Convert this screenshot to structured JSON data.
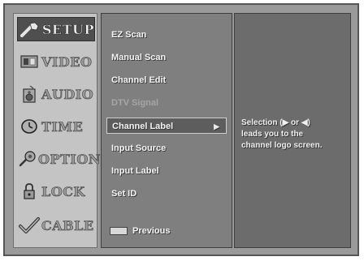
{
  "main_menu": {
    "items": [
      {
        "label": "SETUP",
        "icon": "wrench-icon",
        "selected": true
      },
      {
        "label": "VIDEO",
        "icon": "monitor-icon",
        "selected": false
      },
      {
        "label": "AUDIO",
        "icon": "speaker-icon",
        "selected": false
      },
      {
        "label": "TIME",
        "icon": "clock-icon",
        "selected": false
      },
      {
        "label": "OPTION",
        "icon": "gear-icon",
        "selected": false
      },
      {
        "label": "LOCK",
        "icon": "lock-icon",
        "selected": false
      },
      {
        "label": "CABLE",
        "icon": "checkmark-icon",
        "selected": false
      }
    ]
  },
  "setup_menu": {
    "items": [
      {
        "label": "EZ Scan",
        "state": "normal"
      },
      {
        "label": "Manual Scan",
        "state": "normal"
      },
      {
        "label": "Channel Edit",
        "state": "normal"
      },
      {
        "label": "DTV Signal",
        "state": "disabled"
      },
      {
        "label": "Channel Label",
        "state": "highlighted",
        "arrow": "▶"
      },
      {
        "label": "Input Source",
        "state": "normal"
      },
      {
        "label": "Input Label",
        "state": "normal"
      },
      {
        "label": "Set ID",
        "state": "normal"
      }
    ],
    "previous_label": "Previous"
  },
  "help": {
    "lines": [
      "Selection (▶ or ◀)",
      "leads you to the",
      "channel logo screen."
    ]
  }
}
